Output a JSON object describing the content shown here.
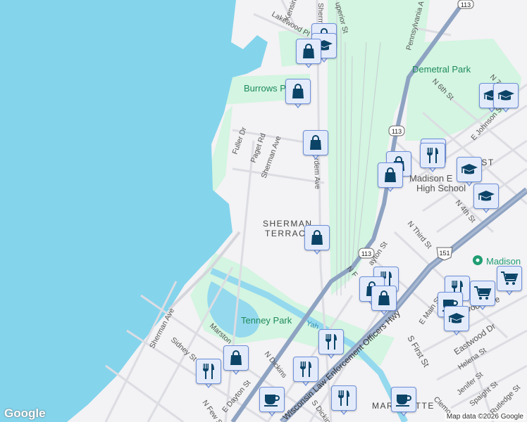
{
  "map": {
    "labels": {
      "sherman_st_top": "Sherm",
      "superior_st": "uperior St",
      "kensington": "Kensin",
      "lakewood_pl": "Lakewood Pl",
      "pennsylvania_ave": "Pennsylvania A",
      "demetral_park": "Demetral Park",
      "n_6th_st": "N 6th St",
      "n_7th": "N 7th",
      "e_johnson": "E Johnson St",
      "burrows_park": "Burrows P",
      "fuller_dr": "Fuller Dr",
      "paget_rd": "Paget Rd",
      "sherman_ave_mid": "Sherman Ave",
      "harbort_ave": "rdem Ave",
      "eken_east": "E     EAST",
      "madison_east_hs_1": "Madison E",
      "madison_east_hs_2": "High School",
      "n_4th": "N 4th St",
      "sherman_terrace_1": "SHERMAN",
      "sherman_terrace_2": "TERRAC",
      "n_third_st": "N Third St",
      "n_dayton_st": "ayton St",
      "n_first": "N F",
      "madison_place": "Madison",
      "atwood_ave": "Atwood Ave",
      "e_main_st": "E Main St",
      "eastwood_dr": "Eastwood Dr",
      "helena_st": "Helena St",
      "jenifer_st": "Jenifer St",
      "spaight_st": "Spaight St",
      "rutledge_st": "Rutledge St",
      "s_first_st": "S First St",
      "clemons": "Clemo",
      "tenney_park": "Tenney Park",
      "yahara": "Yah",
      "sherman_ave_low": "Sherman Ave",
      "sidney_st": "Sidney St",
      "marston": "Marston",
      "n_dickinson": "N Dickins",
      "s_dickinson": "S Dickin",
      "e_dayton_st": "E Dayton St",
      "n_few_st": "N Few St",
      "wi_hwy": "Wisconsin Law Enforcement Officers Hwy",
      "marquette": "MARQUETTE",
      "route_113_a": "113",
      "route_113_b": "113",
      "route_113_c": "113",
      "route_151": "151"
    },
    "markers": [
      {
        "icon": "shopping-bag-icon"
      },
      {
        "icon": "graduation-cap-icon"
      },
      {
        "icon": "shopping-bag-icon"
      },
      {
        "icon": "shopping-bag-icon"
      },
      {
        "icon": "shopping-bag-icon"
      },
      {
        "icon": "shopping-bag-icon"
      },
      {
        "icon": "shopping-bag-icon"
      },
      {
        "icon": "fork-knife-icon"
      },
      {
        "icon": "fork-knife-icon"
      },
      {
        "icon": "graduation-cap-icon"
      },
      {
        "icon": "graduation-cap-icon"
      },
      {
        "icon": "graduation-cap-icon"
      },
      {
        "icon": "graduation-cap-icon"
      },
      {
        "icon": "shopping-bag-icon"
      },
      {
        "icon": "fork-knife-icon"
      },
      {
        "icon": "shopping-bag-icon"
      },
      {
        "icon": "shopping-bag-icon"
      },
      {
        "icon": "fork-knife-icon"
      },
      {
        "icon": "coffee-cup-icon"
      },
      {
        "icon": "graduation-cap-icon"
      },
      {
        "icon": "shopping-cart-icon"
      },
      {
        "icon": "shopping-cart-icon"
      },
      {
        "icon": "fork-knife-icon"
      },
      {
        "icon": "fork-knife-icon"
      },
      {
        "icon": "fork-knife-icon"
      },
      {
        "icon": "shopping-bag-icon"
      },
      {
        "icon": "coffee-cup-icon"
      },
      {
        "icon": "fork-knife-icon"
      },
      {
        "icon": "coffee-cup-icon"
      }
    ],
    "colors": {
      "water": "#84d4ec",
      "park": "#c9f1da",
      "highway": "#8ea3c2",
      "marker_icon": "#0b4467"
    }
  },
  "footer": {
    "logo": "Google",
    "credit": "Map data ©2026 Google"
  }
}
